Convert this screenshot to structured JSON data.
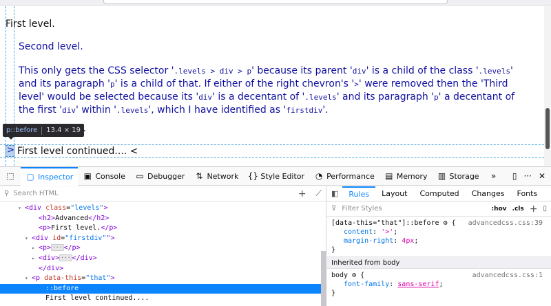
{
  "page": {
    "line1": "First level.",
    "line2": "Second level.",
    "para": [
      [
        "This only gets the CSS selector '",
        {
          "c": ".levels > div > p"
        },
        "' because its parent '",
        {
          "c": "div"
        },
        "' is a child of the class '",
        {
          "c": ".levels"
        },
        "'"
      ],
      [
        "and its paragraph '",
        {
          "c": "p"
        },
        "' is a child of that. If either of the right chevron's '",
        {
          "c": ">"
        },
        "' were removed then the 'Third"
      ],
      [
        "level' would be selected because its '",
        {
          "c": "div"
        },
        "' is a decentant of '",
        {
          "c": ".levels"
        },
        "' and its paragraph '",
        {
          "c": "p"
        },
        "' a decentant of"
      ],
      [
        "the first '",
        {
          "c": "div"
        },
        "' within '",
        {
          "c": ".levels"
        },
        "', which I have identified as '",
        {
          "c": "firstdiv"
        },
        "'."
      ]
    ],
    "line_third_fragment": "el.",
    "line_last": "First level continued.... <",
    "before_marker": ">"
  },
  "tooltip": {
    "selector": "p::before",
    "dims": "13.4 × 19"
  },
  "toolbar": {
    "tabs": [
      {
        "name": "inspector",
        "label": "Inspector",
        "icon": "▢"
      },
      {
        "name": "console",
        "label": "Console",
        "icon": "▣"
      },
      {
        "name": "debugger",
        "label": "Debugger",
        "icon": "▭"
      },
      {
        "name": "network",
        "label": "Network",
        "icon": "⇅"
      },
      {
        "name": "style-editor",
        "label": "Style Editor",
        "icon": "{}"
      },
      {
        "name": "performance",
        "label": "Performance",
        "icon": "◔"
      },
      {
        "name": "memory",
        "label": "Memory",
        "icon": "▤"
      },
      {
        "name": "storage",
        "label": "Storage",
        "icon": "▥"
      }
    ],
    "overflow_icon": "»"
  },
  "tree": {
    "search_placeholder": "Search HTML",
    "rows": [
      {
        "indent": 26,
        "twisty": "▾",
        "html": "<span class='tag'>&lt;div</span> <span class='attr'>class</span>=<span class='val'>\"levels\"</span><span class='tag'>&gt;</span>"
      },
      {
        "indent": 46,
        "twisty": "",
        "html": "<span class='tag'>&lt;h2&gt;</span>Advanced<span class='tag'>&lt;/h2&gt;</span>"
      },
      {
        "indent": 46,
        "twisty": "",
        "html": "<span class='tag'>&lt;p&gt;</span>First level.<span class='tag'>&lt;/p&gt;</span>"
      },
      {
        "indent": 36,
        "twisty": "▾",
        "html": "<span class='tag'>&lt;div</span> <span class='attr'>id</span>=<span class='val'>\"firstdiv\"</span><span class='tag'>\"&gt;</span>"
      },
      {
        "indent": 46,
        "twisty": "▸",
        "html": "<span class='tag'>&lt;p&gt;</span><span class='ellip'>···</span><span class='tag'>&lt;/p&gt;</span>"
      },
      {
        "indent": 46,
        "twisty": "▸",
        "html": "<span class='tag'>&lt;div&gt;</span><span class='ellip'>···</span><span class='tag'>&lt;/div&gt;</span>"
      },
      {
        "indent": 46,
        "twisty": "",
        "html": "<span class='tag'>&lt;/div&gt;</span>"
      },
      {
        "indent": 36,
        "twisty": "▾",
        "html": "<span class='tag'>&lt;p</span> <span class='attr'>data-this</span>=<span class='val'>\"that\"</span><span class='tag'>&gt;</span>"
      },
      {
        "indent": 56,
        "twisty": "",
        "html": "::before",
        "selected": true
      },
      {
        "indent": 56,
        "twisty": "",
        "html": "First level continued...."
      }
    ]
  },
  "rules": {
    "tabs": [
      "Rules",
      "Layout",
      "Computed",
      "Changes",
      "Fonts"
    ],
    "filter_placeholder": "Filter Styles",
    "hov": ":hov",
    "cls": ".cls",
    "rule1": {
      "selector": "[data-this=\"that\"]::before",
      "source": "advancedcss.css:39",
      "decls": [
        {
          "prop": "content",
          "value": "'>'"
        },
        {
          "prop": "margin-right",
          "value": "4px"
        }
      ]
    },
    "inherited_label": "Inherited from body",
    "rule2": {
      "selector": "body",
      "source": "advancedcss.css:1",
      "decls": [
        {
          "prop": "font-family",
          "value": "sans-serif"
        }
      ]
    }
  }
}
